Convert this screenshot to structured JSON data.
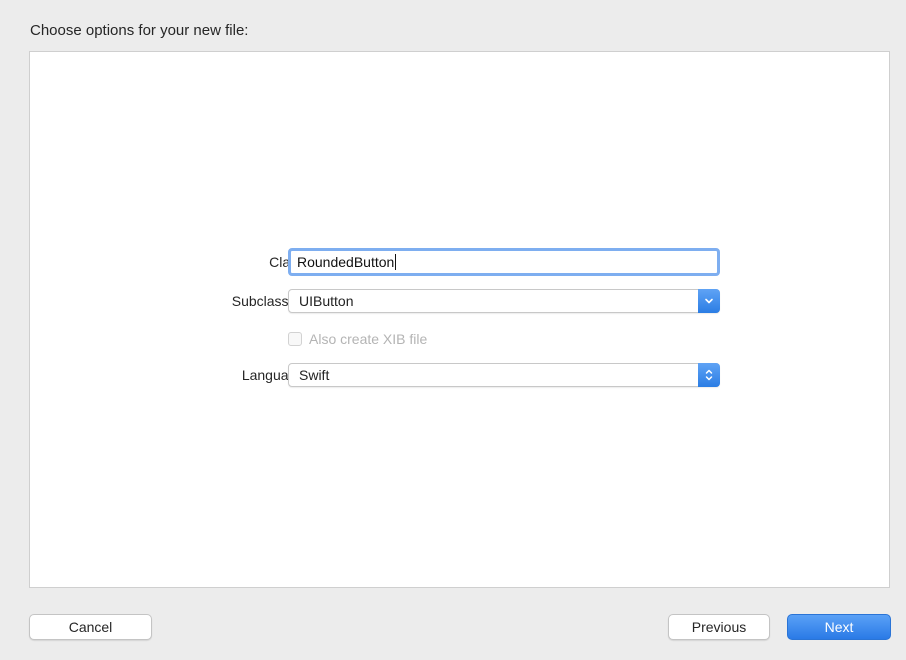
{
  "dialog": {
    "title": "Choose options for your new file:"
  },
  "form": {
    "class": {
      "label": "Class:",
      "value": "RoundedButton"
    },
    "subclass": {
      "label": "Subclass of:",
      "value": "UIButton"
    },
    "xib": {
      "label": "Also create XIB file",
      "checked": false,
      "enabled": false
    },
    "language": {
      "label": "Language:",
      "value": "Swift"
    }
  },
  "buttons": {
    "cancel": "Cancel",
    "previous": "Previous",
    "next": "Next"
  },
  "colors": {
    "accent": "#2f7fe6",
    "focus_ring": "#7eaef0",
    "background": "#ececec"
  },
  "icons": {
    "subclass_dropdown": "chevron-down-icon",
    "language_dropdown": "up-down-chevron-icon"
  }
}
